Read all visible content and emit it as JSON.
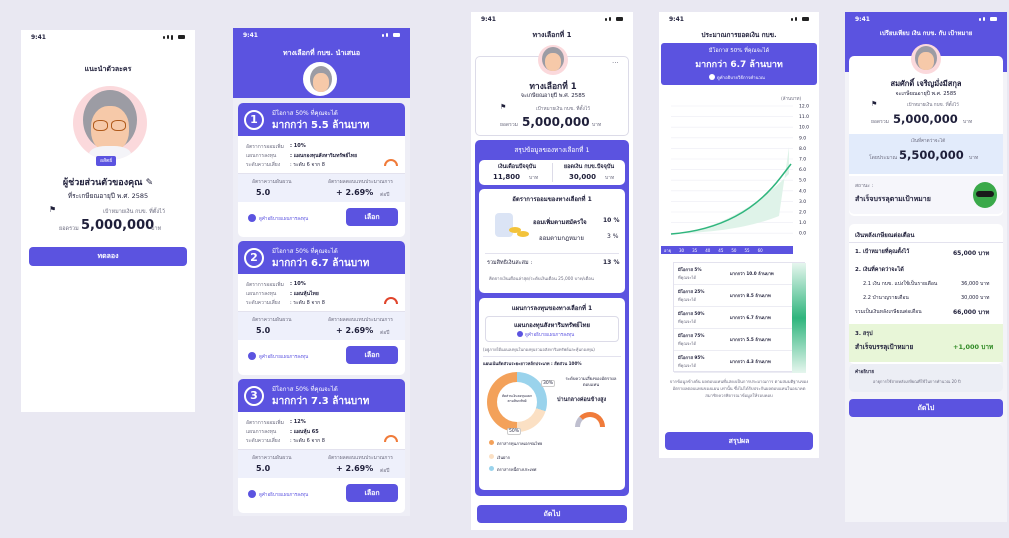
{
  "status_time": "9:41",
  "s1": {
    "title": "แนะนำตัวละคร",
    "badge": "อสัตย์",
    "name": "ผู้ช่วยส่วนตัวของคุณ",
    "birth": "ที่ระเกษียณอายุปี พ.ศ. 2585",
    "goal_label": "เป้าหมายเงิน กบข. ที่ตั้งไว้",
    "total_label": "ยอดรวม",
    "amount": "5,000,000",
    "unit": "บาท",
    "button": "ทดลอง"
  },
  "s2": {
    "header": "ทางเลือกที่ กบข. นำเสนอ",
    "options": [
      {
        "num": "1",
        "prob": "มีโอกาส 50% ที่คุณจะได้",
        "amount": "มากกว่า 5.5 ล้านบาท",
        "l1": "อัตราการออมเพิ่ม",
        "v1": ": 10%",
        "l2": "แผนการลงทุน",
        "v2": ": แผนกองทุนสังหาริมทรัพย์ไทย",
        "l3": "ระดับความเสี่ยง",
        "v3": ": ระดับ 6 จาก 8",
        "c1": "อัตราความผันผวน",
        "c1v": "5.0",
        "c2": "อัตราผลตอบแทนประมาณการ",
        "c2v": "+ 2.69%",
        "c2u": "ต่อปี",
        "link": "ดูคำอธิบายแผนการลงทุน",
        "btn": "เลือก"
      },
      {
        "num": "2",
        "prob": "มีโอกาส 50% ที่คุณจะได้",
        "amount": "มากกว่า 6.7 ล้านบาท",
        "l1": "อัตราการออมเพิ่ม",
        "v1": ": 10%",
        "l2": "แผนการลงทุน",
        "v2": ": แผนหุ้นไทย",
        "l3": "ระดับความเสี่ยง",
        "v3": ": ระดับ 8 จาก 8",
        "c1": "อัตราความผันผวน",
        "c1v": "5.0",
        "c2": "อัตราผลตอบแทนประมาณการ",
        "c2v": "+ 2.69%",
        "c2u": "ต่อปี",
        "link": "ดูคำอธิบายแผนการลงทุน",
        "btn": "เลือก"
      },
      {
        "num": "3",
        "prob": "มีโอกาส 50% ที่คุณจะได้",
        "amount": "มากกว่า 7.3 ล้านบาท",
        "l1": "อัตราการออมเพิ่ม",
        "v1": ": 12%",
        "l2": "แผนการลงทุน",
        "v2": ": แผนหุ้น 65",
        "l3": "ระดับความเสี่ยง",
        "v3": ": ระดับ 6 จาก 8",
        "c1": "อัตราความผันผวน",
        "c1v": "5.0",
        "c2": "อัตราผลตอบแทนประมาณการ",
        "c2v": "+ 2.69%",
        "c2u": "ต่อปี",
        "link": "ดูคำอธิบายแผนการลงทุน",
        "btn": "เลือก"
      }
    ]
  },
  "s3": {
    "header": "ทางเลือกที่ 1",
    "card_title": "ทางเลือกที่ 1",
    "birth": "จะเกษียณอายุปี พ.ศ. 2585",
    "goal_label": "เป้าหมายเงิน กบข. ที่ตั้งไว้",
    "total_label": "ยอดรวม",
    "amount": "5,000,000",
    "unit": "บาท",
    "summary_title": "สรุปข้อมูลของทางเลือกที่ 1",
    "col1_label": "เงินเดือนปัจจุบัน",
    "col1_value": "11,800",
    "col2_label": "ยอดเงิน กบข.ปัจจุบัน",
    "col2_value": "30,000",
    "unit_short": "บาท",
    "rate_title": "อัตราการออมของทางเลือกที่ 1",
    "rate1_label": "ออมเพิ่มตามสมัครใจ",
    "rate1_value": "10 %",
    "rate2_label": "ออมตามกฎหมาย",
    "rate2_value": "3 %",
    "rate_total_label": "รวมสิทธิเงินสะสม :",
    "rate_total_value": "13 %",
    "rate_note": "คิดจากเงินเดือนล่าสุด/ระดับเงินเดือน 25,000 บาท/เดือน",
    "plan_title": "แผนการลงทุนของทางเลือกที่ 1",
    "plan_name": "แผนกองทุนสังหาริมทรัพย์ไทย",
    "plan_link": "ดูคำอธิบายแผนการลงทุน",
    "plan_desc": "(อยู่ภายใต้แผนลงทุนในกองทุนรวมอสังหาริมทรัพย์และหุ้นกองทุน)",
    "alloc_title": "แผนเน้นสัดส่วนระยะยาวหลักประเภท : สัดส่วน 100%",
    "donut_center": "สัดส่วนเงินลงทุนแยกตามสินทรัพย์",
    "donut_pct1": "50%",
    "donut_pct2": "30%",
    "legend": [
      "ตราสารทุนภาคเอกชนไทย",
      "เงินฝาก",
      "ตราสารหนี้ต่างประเทศ"
    ],
    "risk_label": "ระดับความเสี่ยงของอัตราผลตอบแทน",
    "risk_value": "ปานกลางค่อนข้างสูง",
    "button": "ถัดไป"
  },
  "s4": {
    "header": "ประมาณการยอดเงิน กบข.",
    "prob": "มีโอกาส 50% ที่คุณจะได้",
    "amount": "มากกว่า 6.7 ล้านบาท",
    "note": "ดูคำอธิบายวิธีการคำนวณ",
    "unit_label": "(ล้านบาท)",
    "y_ticks": [
      "12.0",
      "11.0",
      "10.0",
      "9.0",
      "8.0",
      "7.0",
      "6.0",
      "5.0",
      "4.0",
      "3.0",
      "2.0",
      "1.0",
      "0.0"
    ],
    "x_label": "อายุ",
    "x_ticks": [
      "30",
      "35",
      "40",
      "45",
      "50",
      "55",
      "60"
    ],
    "rows": [
      {
        "p": "มีโอกาส 5%",
        "s": "ที่คุณจะได้",
        "v": "มากกว่า 10.0 ล้านบาท"
      },
      {
        "p": "มีโอกาส 25%",
        "s": "ที่คุณจะได้",
        "v": "มากกว่า 8.5 ล้านบาท"
      },
      {
        "p": "มีโอกาส 50%",
        "s": "ที่คุณจะได้",
        "v": "มากกว่า 6.7 ล้านบาท"
      },
      {
        "p": "มีโอกาส 75%",
        "s": "ที่คุณจะได้",
        "v": "มากกว่า 5.5 ล้านบาท"
      },
      {
        "p": "มีโอกาส 95%",
        "s": "ที่คุณจะได้",
        "v": "มากกว่า 4.3 ล้านบาท"
      }
    ],
    "disclaimer": "จากข้อมูลข้างต้น ผลตอบแทนที่แสดงเป็นการประมาณการ ตามสมมติฐานของอัตราผลตอบแทนของแผน เท่านั้น ซึ่งไม่ได้รับประกันผลตอบแทนในอนาคต สมาชิกควรพิจารณาข้อมูลให้รอบคอบ",
    "button": "สรุปผล"
  },
  "s5": {
    "header": "เปรียบเทียบ เงิน กบข. กับ เป้าหมาย",
    "name": "สมศักดิ์ เจริญมั่งมีสกุล",
    "birth": "จะเกษียณอายุปี พ.ศ. 2585",
    "goal_label": "เป้าหมายเงิน กบข. ที่ตั้งไว้",
    "total_label": "ยอดรวม",
    "amount": "5,000,000",
    "unit": "บาท",
    "est_label": "เงินที่คาดว่าจะได้",
    "est_sub": "โดยประมาณ",
    "est_amount": "5,500,000",
    "status_label": "สถานะ :",
    "status_value": "สำเร็จบรรลุตามเป้าหมาย",
    "section_title": "เงินหลังเกษียณต่อเดือน",
    "l1": "1. เป้าหมายที่คุณตั้งไว้",
    "v1": "65,000 บาท",
    "l2": "2. เงินที่คาดว่าจะได้",
    "l21": "2.1 เงิน กบข. แบ่งใช้เป็นรายเดือน",
    "v21": "36,000 บาท",
    "l22": "2.2 บำนาญรายเดือน",
    "v22": "30,000 บาท",
    "l23": "รวมเป็นเงินหลังเกษียณต่อเดือน",
    "v23": "66,000 บาท",
    "l3": "3. สรุป",
    "v3_label": "สำเร็จบรรลุเป้าหมาย",
    "v3": "+1,000 บาท",
    "fn_title": "คำอธิบาย",
    "fn_text": "อายุการใช้จ่ายหลังเกษียณที่ใช้ในการคำนวณ 20 ปี",
    "button": "ถัดไป"
  }
}
